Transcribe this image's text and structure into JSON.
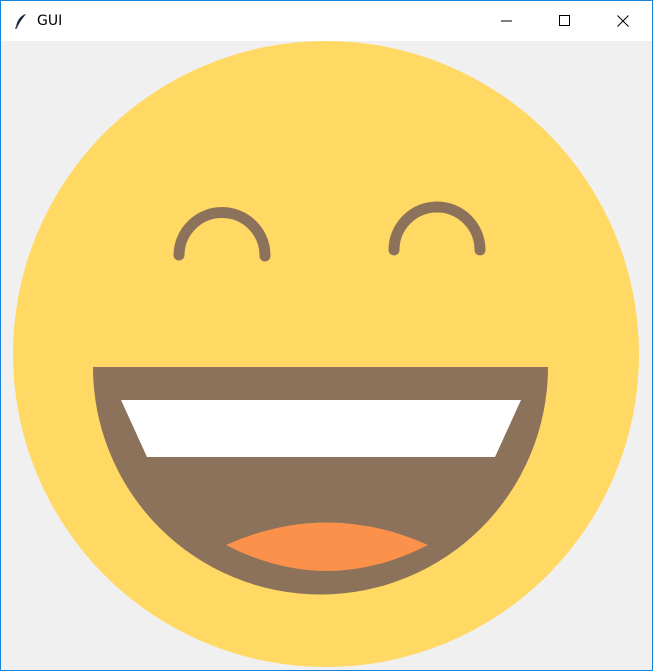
{
  "window": {
    "title": "GUI",
    "app_icon": "feather-icon",
    "controls": [
      "minimize-icon",
      "maximize-icon",
      "close-icon"
    ]
  },
  "colors": {
    "face": "#ffd964",
    "features": "#8c725a",
    "teeth": "#ffffff",
    "tongue": "#fb914a",
    "background": "#f0f0f0",
    "border": "#1883d7"
  }
}
